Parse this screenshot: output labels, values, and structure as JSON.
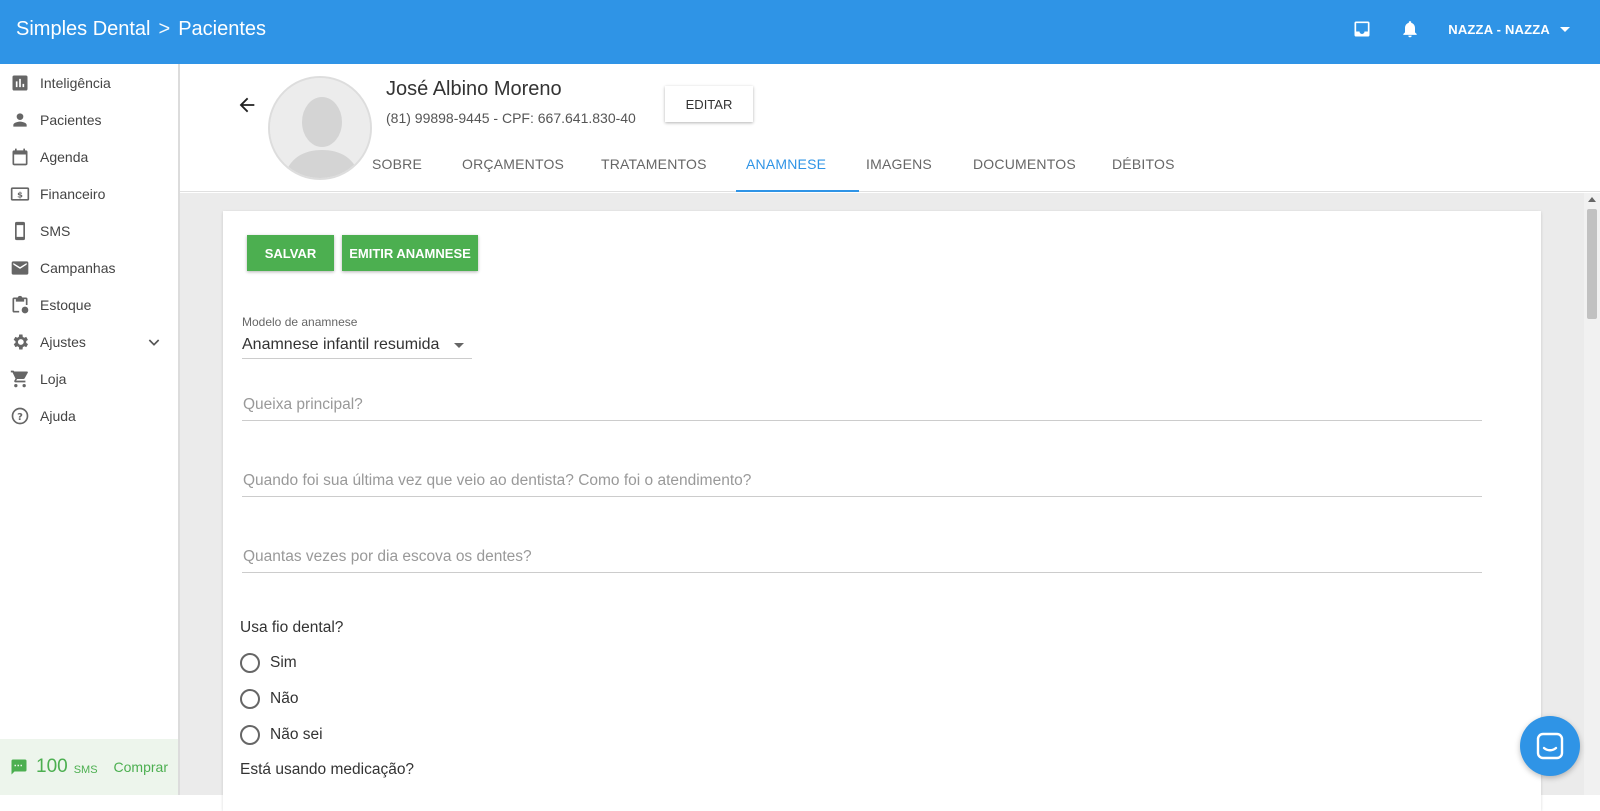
{
  "topbar": {
    "app_name": "Simples Dental",
    "breadcrumb_separator": ">",
    "section": "Pacientes",
    "user": "NAZZA - NAZZA",
    "icons": [
      "inbox-icon",
      "bell-icon",
      "caret-down-icon"
    ],
    "bg_color": "#2f94e6"
  },
  "sidebar": {
    "items": [
      {
        "label": "Inteligência",
        "icon": "bar-chart-icon"
      },
      {
        "label": "Pacientes",
        "icon": "person-icon"
      },
      {
        "label": "Agenda",
        "icon": "calendar-icon"
      },
      {
        "label": "Financeiro",
        "icon": "money-icon"
      },
      {
        "label": "SMS",
        "icon": "phone-icon"
      },
      {
        "label": "Campanhas",
        "icon": "mail-icon"
      },
      {
        "label": "Estoque",
        "icon": "clipboard-icon"
      },
      {
        "label": "Ajustes",
        "icon": "gear-icon"
      },
      {
        "label": "Loja",
        "icon": "cart-icon"
      },
      {
        "label": "Ajuda",
        "icon": "help-icon"
      }
    ],
    "sms": {
      "count": "100",
      "unit": "SMS",
      "buy": "Comprar",
      "color": "#4caf50"
    }
  },
  "patient": {
    "name": "José Albino Moreno",
    "info": "(81) 99898-9445 - CPF: 667.641.830-40",
    "edit_label": "EDITAR"
  },
  "tabs": [
    {
      "label": "SOBRE",
      "active": false
    },
    {
      "label": "ORÇAMENTOS",
      "active": false
    },
    {
      "label": "TRATAMENTOS",
      "active": false
    },
    {
      "label": "ANAMNESE",
      "active": true
    },
    {
      "label": "IMAGENS",
      "active": false
    },
    {
      "label": "DOCUMENTOS",
      "active": false
    },
    {
      "label": "DÉBITOS",
      "active": false
    }
  ],
  "form": {
    "save_label": "SALVAR",
    "emit_label": "EMITIR ANAMNESE",
    "model_label": "Modelo de anamnese",
    "model_value": "Anamnese infantil resumida",
    "fields": [
      {
        "placeholder": "Queixa principal?"
      },
      {
        "placeholder": "Quando foi sua última vez que veio ao dentista? Como foi o atendimento?"
      },
      {
        "placeholder": "Quantas vezes por dia escova os dentes?"
      }
    ],
    "q_floss": "Usa fio dental?",
    "options": [
      "Sim",
      "Não",
      "Não sei"
    ],
    "q_medication": "Está usando medicação?"
  }
}
